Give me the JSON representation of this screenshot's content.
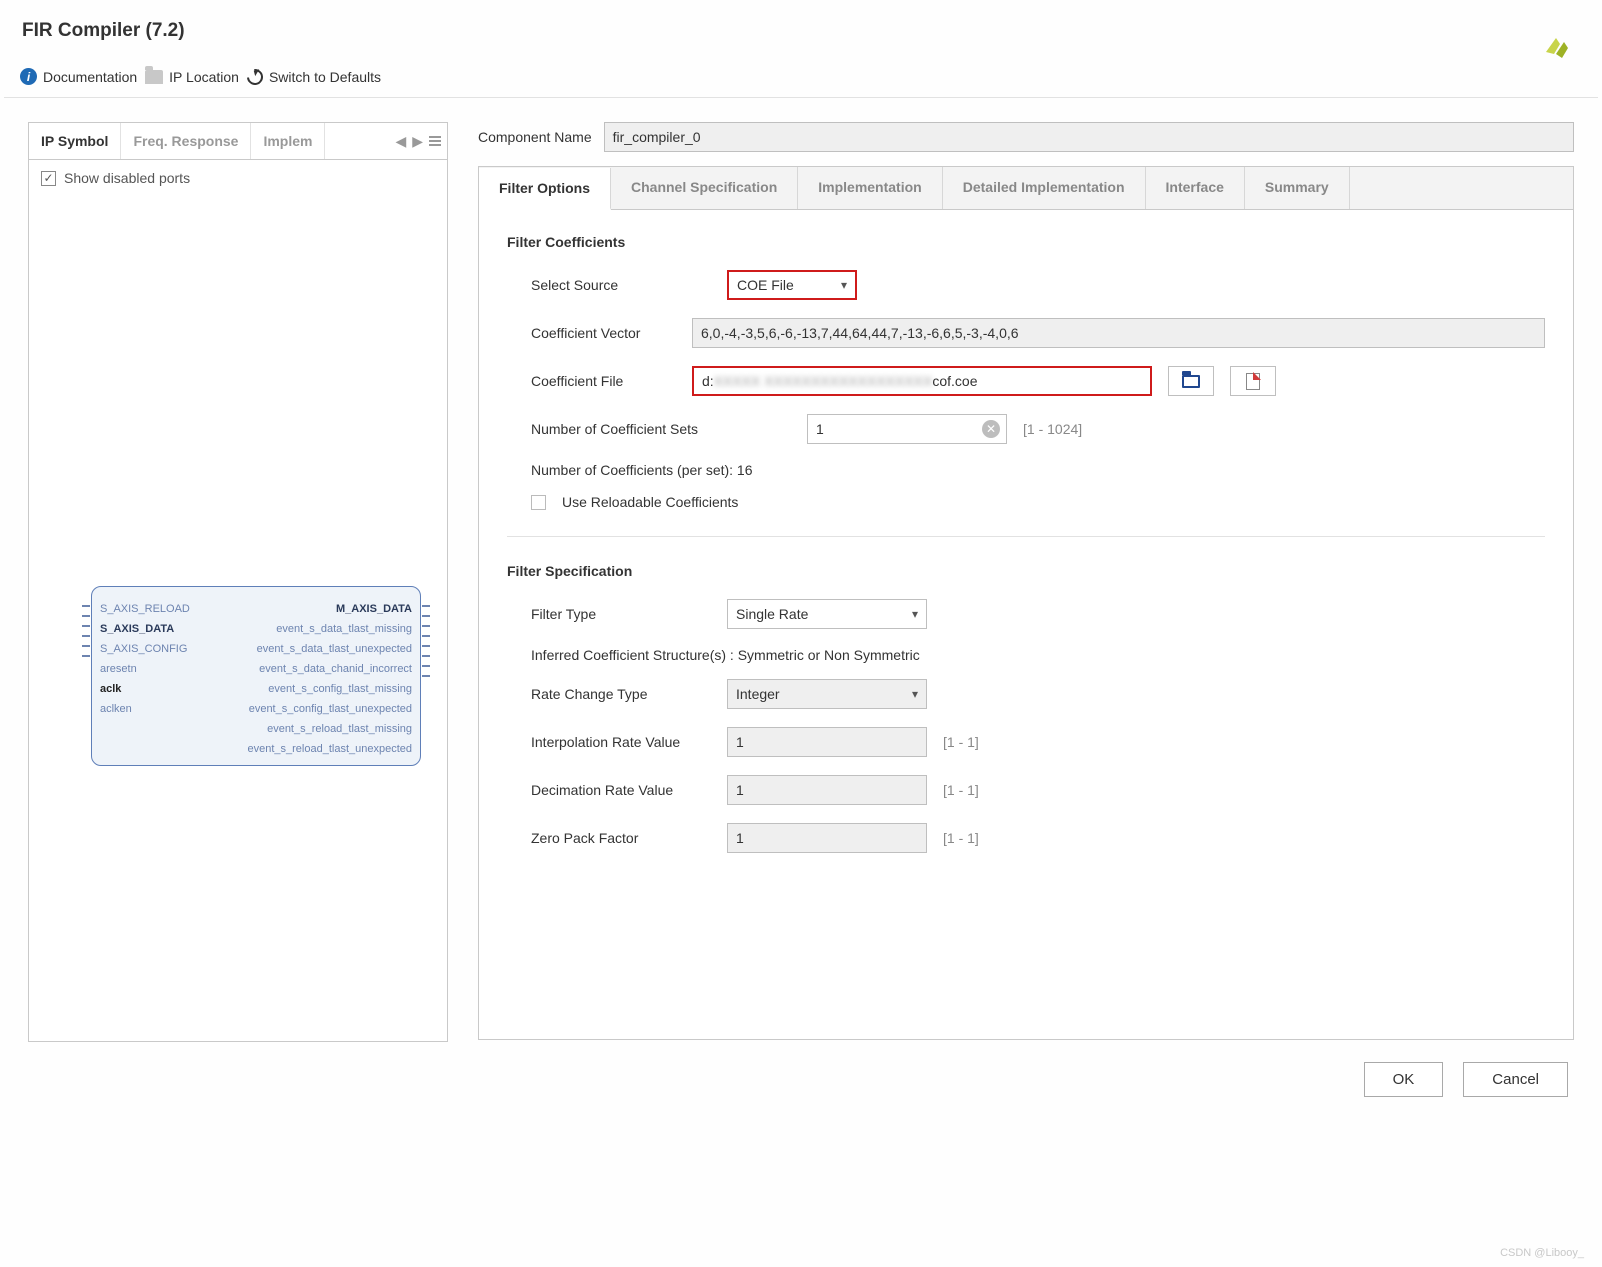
{
  "title": "FIR Compiler (7.2)",
  "toolbar": {
    "doc": "Documentation",
    "iploc": "IP Location",
    "defaults": "Switch to Defaults"
  },
  "left_tabs": [
    "IP Symbol",
    "Freq. Response",
    "Implem"
  ],
  "show_disabled": "Show disabled ports",
  "pins_left": [
    "S_AXIS_RELOAD",
    "S_AXIS_DATA",
    "S_AXIS_CONFIG",
    "aresetn",
    "aclk",
    "aclken"
  ],
  "pins_right": [
    "M_AXIS_DATA",
    "event_s_data_tlast_missing",
    "event_s_data_tlast_unexpected",
    "event_s_data_chanid_incorrect",
    "event_s_config_tlast_missing",
    "event_s_config_tlast_unexpected",
    "event_s_reload_tlast_missing",
    "event_s_reload_tlast_unexpected"
  ],
  "comp_name_lbl": "Component Name",
  "comp_name": "fir_compiler_0",
  "tabs": [
    "Filter Options",
    "Channel Specification",
    "Implementation",
    "Detailed Implementation",
    "Interface",
    "Summary"
  ],
  "section1": "Filter Coefficients",
  "sel_src_lbl": "Select Source",
  "sel_src": "COE File",
  "cvec_lbl": "Coefficient Vector",
  "cvec": "6,0,-4,-3,5,6,-6,-13,7,44,64,44,7,-13,-6,6,5,-3,-4,0,6",
  "cfile_lbl": "Coefficient File",
  "cfile_prefix": "d:",
  "cfile_hidden": "XXXXX XXXXXXXXXXXXXXXXXX",
  "cfile_suffix": "cof.coe",
  "nsets_lbl": "Number of Coefficient Sets",
  "nsets": "1",
  "nsets_hint": "[1 - 1024]",
  "nps": "Number of Coefficients (per set): 16",
  "reload": "Use Reloadable Coefficients",
  "section2": "Filter Specification",
  "ftype_lbl": "Filter Type",
  "ftype": "Single Rate",
  "infer": "Inferred Coefficient Structure(s) : Symmetric or Non Symmetric",
  "rct_lbl": "Rate Change Type",
  "rct": "Integer",
  "irv_lbl": "Interpolation Rate Value",
  "irv": "1",
  "irv_hint": "[1 - 1]",
  "drv_lbl": "Decimation Rate Value",
  "drv": "1",
  "drv_hint": "[1 - 1]",
  "zpf_lbl": "Zero Pack Factor",
  "zpf": "1",
  "zpf_hint": "[1 - 1]",
  "ok": "OK",
  "cancel": "Cancel",
  "watermark": "CSDN @Libooy_"
}
